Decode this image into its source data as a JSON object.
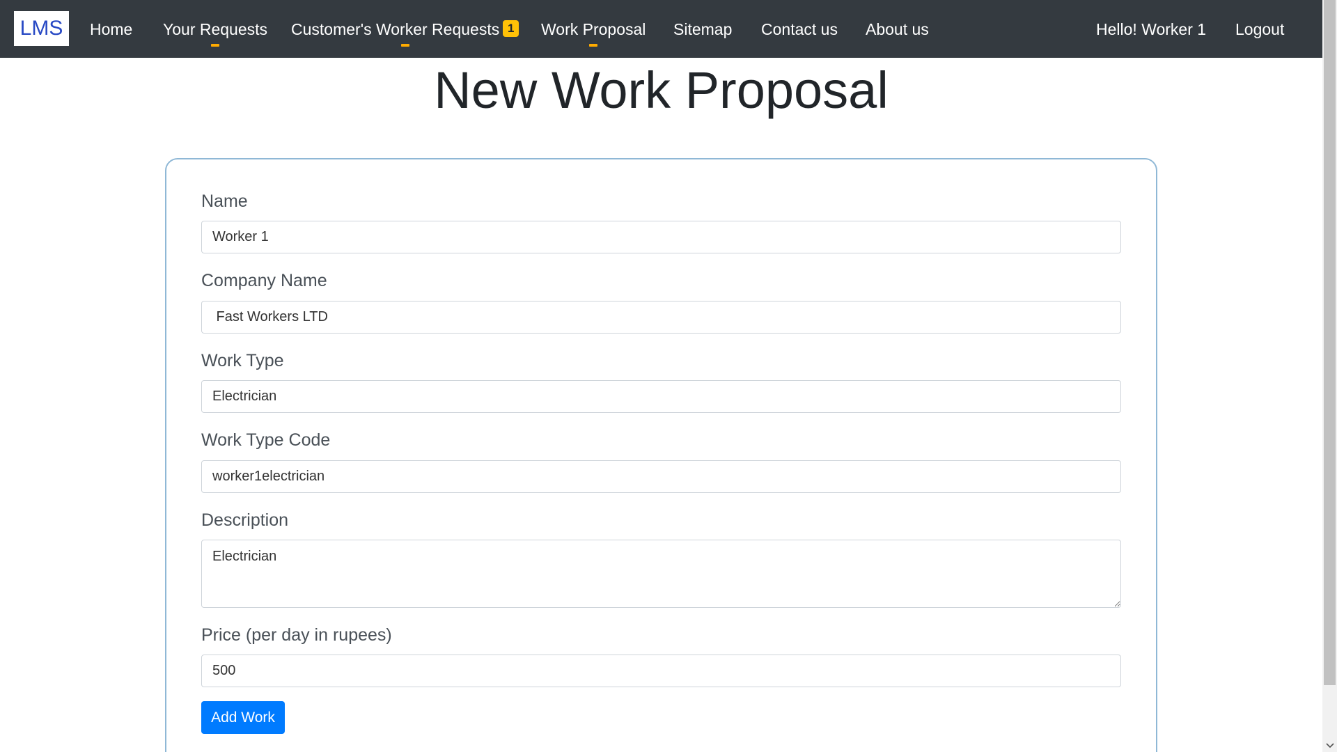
{
  "brand": "LMS",
  "nav": {
    "home": "Home",
    "your_requests": "Your Requests",
    "customer_worker_requests": "Customer's Worker Requests",
    "customer_worker_requests_badge": "1",
    "work_proposal": "Work Proposal",
    "sitemap": "Sitemap",
    "contact": "Contact us",
    "about": "About us",
    "greeting": "Hello! Worker 1",
    "logout": "Logout"
  },
  "accent_color": "#ffab00",
  "page_title": "New Work Proposal",
  "form": {
    "name": {
      "label": "Name",
      "value": "Worker 1"
    },
    "company": {
      "label": "Company Name",
      "value": " Fast Workers LTD"
    },
    "work_type": {
      "label": "Work Type",
      "value": "Electrician"
    },
    "work_type_code": {
      "label": "Work Type Code",
      "value": "worker1electrician"
    },
    "description": {
      "label": "Description",
      "value": "Electrician"
    },
    "price": {
      "label": "Price (per day in rupees)",
      "value": "500"
    },
    "submit_label": "Add Work"
  }
}
